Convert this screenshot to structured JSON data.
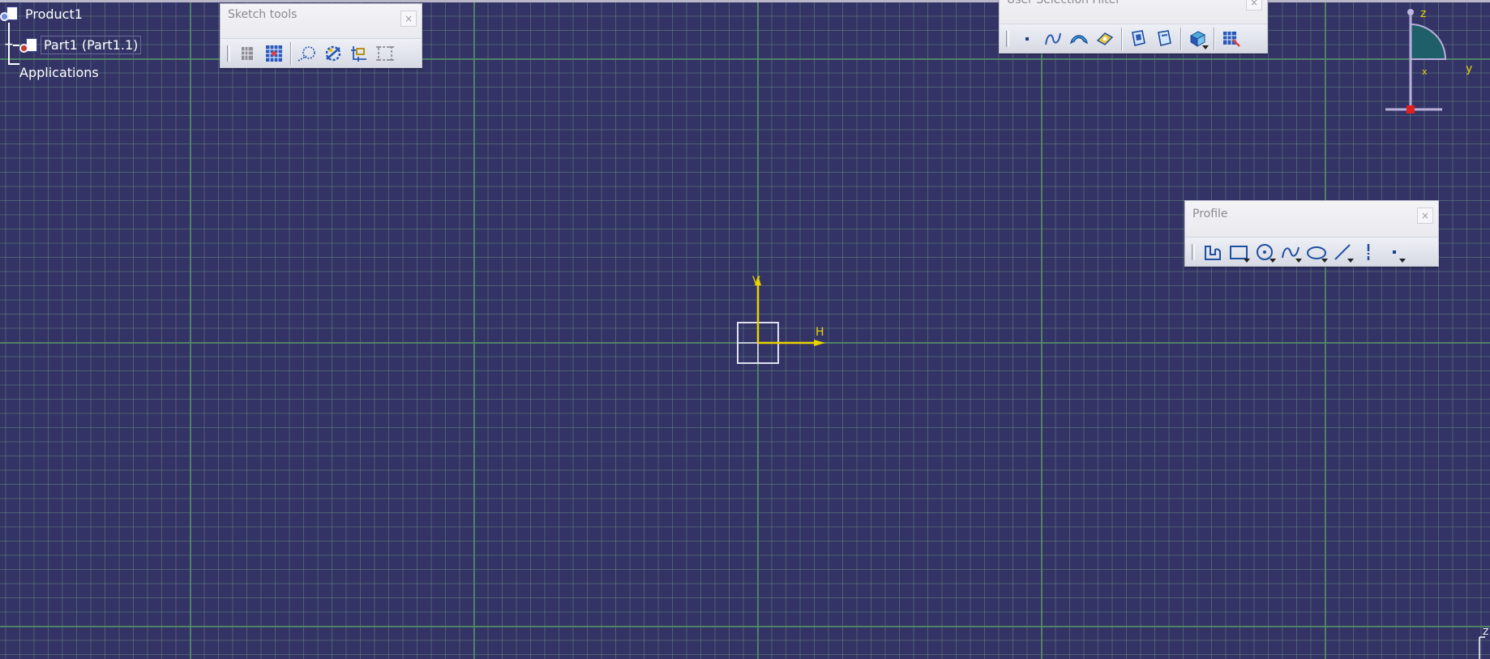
{
  "tree": {
    "root": "Product1",
    "part": "Part1 (Part1.1)",
    "applications": "Applications"
  },
  "toolbars": {
    "sketch_tools": {
      "title": "Sketch tools",
      "close": "×",
      "icons": [
        "grid-snap-icon",
        "snap-to-point-icon",
        "construction-element-icon",
        "geometrical-constraints-icon",
        "dimensional-constraints-icon",
        "auto-constraint-icon"
      ]
    },
    "user_selection_filter": {
      "title": "User Selection Filter",
      "close": "×",
      "icons": [
        "point-filter-icon",
        "curve-filter-icon",
        "surface-filter-icon",
        "volume-filter-icon",
        "feature-element-filter-icon",
        "geometrical-element-filter-icon",
        "intersection-edges-icon",
        "quick-select-icon"
      ]
    },
    "profile": {
      "title": "Profile",
      "close": "×",
      "icons": [
        "profile-icon",
        "rectangle-icon",
        "circle-icon",
        "spline-icon",
        "ellipse-icon",
        "line-icon",
        "axis-icon",
        "point-icon"
      ]
    }
  },
  "compass": {
    "z": "z",
    "y": "y",
    "x": "x"
  },
  "sketch_axis": {
    "v": "V",
    "h": "H"
  },
  "corner_axis": {
    "z": "Z"
  },
  "colors": {
    "background": "#333366",
    "grid_major": "#508c64",
    "axis": "#e8d400",
    "toolbar_icon": "#1f4f9f"
  }
}
